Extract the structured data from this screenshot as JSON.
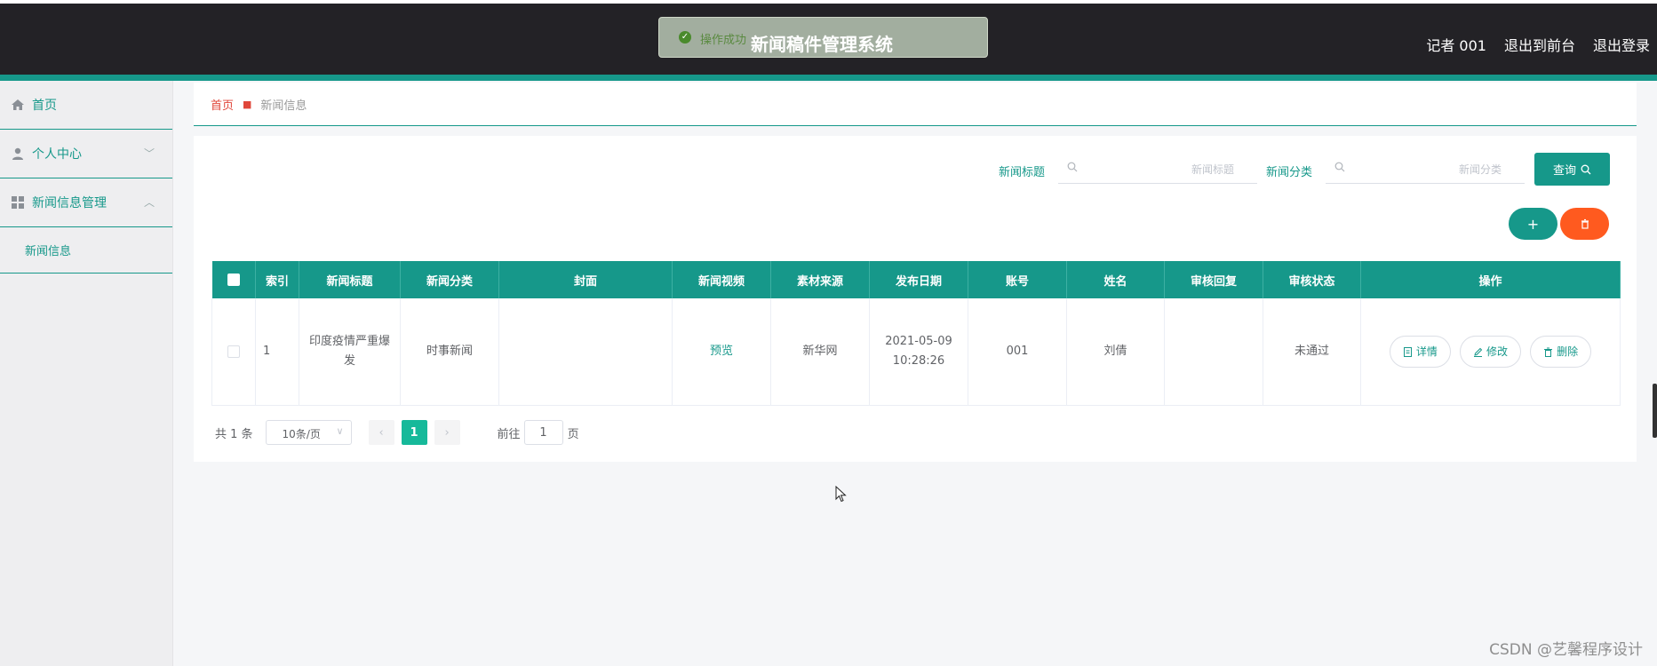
{
  "header": {
    "title": "新闻稿件管理系统",
    "toast": "操作成功",
    "user": "记者 001",
    "links": [
      "退出到前台",
      "退出登录"
    ]
  },
  "sidebar": {
    "items": [
      {
        "label": "首页",
        "icon": "home-icon"
      },
      {
        "label": "个人中心",
        "icon": "user-icon"
      },
      {
        "label": "新闻信息管理",
        "icon": "grid-icon"
      }
    ],
    "subitem": "新闻信息"
  },
  "breadcrumb": {
    "home": "首页",
    "current": "新闻信息"
  },
  "search": {
    "title_label": "新闻标题",
    "title_placeholder": "新闻标题",
    "category_label": "新闻分类",
    "category_placeholder": "新闻分类",
    "query_button": "查询"
  },
  "table": {
    "headers": [
      "索引",
      "新闻标题",
      "新闻分类",
      "封面",
      "新闻视频",
      "素材来源",
      "发布日期",
      "账号",
      "姓名",
      "审核回复",
      "审核状态",
      "操作"
    ],
    "rows": [
      {
        "index": "1",
        "title": "印度疫情严重爆发",
        "category": "时事新闻",
        "cover": "",
        "video": "预览",
        "source": "新华网",
        "date": "2021-05-09 10:28:26",
        "account": "001",
        "name": "刘倩",
        "reply": "",
        "status": "未通过"
      }
    ],
    "actions": [
      "详情",
      "修改",
      "删除"
    ]
  },
  "pagination": {
    "total": "共 1 条",
    "page_size": "10条/页",
    "current_page": "1",
    "goto_label": "前往",
    "goto_value": "1",
    "page_suffix": "页"
  },
  "watermark": "CSDN @艺馨程序设计",
  "colors": {
    "accent": "#16988a",
    "danger": "#ff5a1f",
    "header_bg": "#232226"
  }
}
